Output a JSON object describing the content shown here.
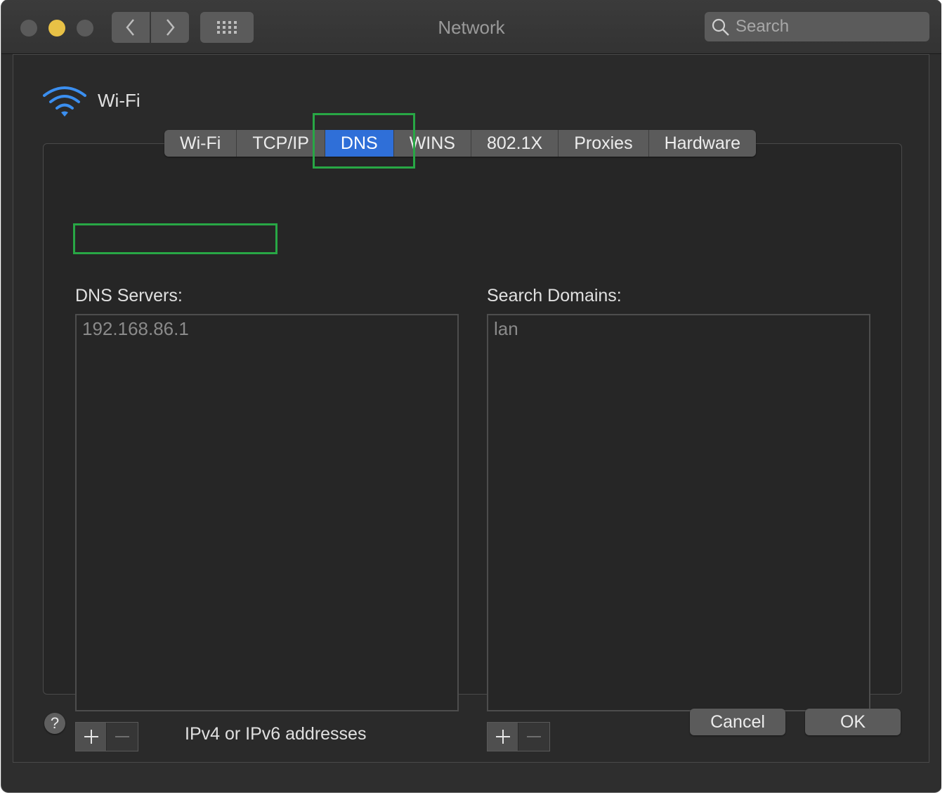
{
  "window": {
    "title": "Network"
  },
  "toolbar": {
    "search_placeholder": "Search",
    "back_icon": "chevron-left-icon",
    "forward_icon": "chevron-right-icon",
    "show_all_icon": "grid-icon"
  },
  "service": {
    "name": "Wi-Fi",
    "icon": "wifi-icon"
  },
  "tabs": [
    {
      "label": "Wi-Fi",
      "active": false
    },
    {
      "label": "TCP/IP",
      "active": false
    },
    {
      "label": "DNS",
      "active": true
    },
    {
      "label": "WINS",
      "active": false
    },
    {
      "label": "802.1X",
      "active": false
    },
    {
      "label": "Proxies",
      "active": false
    },
    {
      "label": "Hardware",
      "active": false
    }
  ],
  "dns": {
    "servers_label": "DNS Servers:",
    "servers": [
      "192.168.86.1"
    ],
    "domains_label": "Search Domains:",
    "domains": [
      "lan"
    ],
    "hint": "IPv4 or IPv6 addresses"
  },
  "footer": {
    "help": "?",
    "cancel": "Cancel",
    "ok": "OK"
  },
  "colors": {
    "accent": "#2f6fd8",
    "highlight": "#28a745",
    "traffic_minimize": "#e8c146",
    "wifi": "#3b8ff0"
  }
}
